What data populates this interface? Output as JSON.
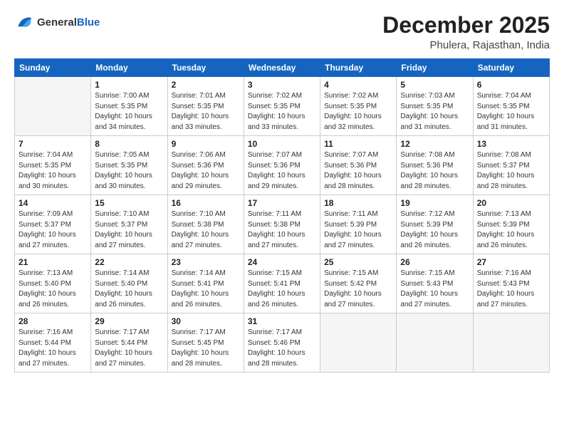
{
  "logo": {
    "general": "General",
    "blue": "Blue"
  },
  "header": {
    "month": "December 2025",
    "location": "Phulera, Rajasthan, India"
  },
  "weekdays": [
    "Sunday",
    "Monday",
    "Tuesday",
    "Wednesday",
    "Thursday",
    "Friday",
    "Saturday"
  ],
  "weeks": [
    [
      {
        "day": "",
        "info": ""
      },
      {
        "day": "1",
        "info": "Sunrise: 7:00 AM\nSunset: 5:35 PM\nDaylight: 10 hours\nand 34 minutes."
      },
      {
        "day": "2",
        "info": "Sunrise: 7:01 AM\nSunset: 5:35 PM\nDaylight: 10 hours\nand 33 minutes."
      },
      {
        "day": "3",
        "info": "Sunrise: 7:02 AM\nSunset: 5:35 PM\nDaylight: 10 hours\nand 33 minutes."
      },
      {
        "day": "4",
        "info": "Sunrise: 7:02 AM\nSunset: 5:35 PM\nDaylight: 10 hours\nand 32 minutes."
      },
      {
        "day": "5",
        "info": "Sunrise: 7:03 AM\nSunset: 5:35 PM\nDaylight: 10 hours\nand 31 minutes."
      },
      {
        "day": "6",
        "info": "Sunrise: 7:04 AM\nSunset: 5:35 PM\nDaylight: 10 hours\nand 31 minutes."
      }
    ],
    [
      {
        "day": "7",
        "info": "Sunrise: 7:04 AM\nSunset: 5:35 PM\nDaylight: 10 hours\nand 30 minutes."
      },
      {
        "day": "8",
        "info": "Sunrise: 7:05 AM\nSunset: 5:35 PM\nDaylight: 10 hours\nand 30 minutes."
      },
      {
        "day": "9",
        "info": "Sunrise: 7:06 AM\nSunset: 5:36 PM\nDaylight: 10 hours\nand 29 minutes."
      },
      {
        "day": "10",
        "info": "Sunrise: 7:07 AM\nSunset: 5:36 PM\nDaylight: 10 hours\nand 29 minutes."
      },
      {
        "day": "11",
        "info": "Sunrise: 7:07 AM\nSunset: 5:36 PM\nDaylight: 10 hours\nand 28 minutes."
      },
      {
        "day": "12",
        "info": "Sunrise: 7:08 AM\nSunset: 5:36 PM\nDaylight: 10 hours\nand 28 minutes."
      },
      {
        "day": "13",
        "info": "Sunrise: 7:08 AM\nSunset: 5:37 PM\nDaylight: 10 hours\nand 28 minutes."
      }
    ],
    [
      {
        "day": "14",
        "info": "Sunrise: 7:09 AM\nSunset: 5:37 PM\nDaylight: 10 hours\nand 27 minutes."
      },
      {
        "day": "15",
        "info": "Sunrise: 7:10 AM\nSunset: 5:37 PM\nDaylight: 10 hours\nand 27 minutes."
      },
      {
        "day": "16",
        "info": "Sunrise: 7:10 AM\nSunset: 5:38 PM\nDaylight: 10 hours\nand 27 minutes."
      },
      {
        "day": "17",
        "info": "Sunrise: 7:11 AM\nSunset: 5:38 PM\nDaylight: 10 hours\nand 27 minutes."
      },
      {
        "day": "18",
        "info": "Sunrise: 7:11 AM\nSunset: 5:39 PM\nDaylight: 10 hours\nand 27 minutes."
      },
      {
        "day": "19",
        "info": "Sunrise: 7:12 AM\nSunset: 5:39 PM\nDaylight: 10 hours\nand 26 minutes."
      },
      {
        "day": "20",
        "info": "Sunrise: 7:13 AM\nSunset: 5:39 PM\nDaylight: 10 hours\nand 26 minutes."
      }
    ],
    [
      {
        "day": "21",
        "info": "Sunrise: 7:13 AM\nSunset: 5:40 PM\nDaylight: 10 hours\nand 26 minutes."
      },
      {
        "day": "22",
        "info": "Sunrise: 7:14 AM\nSunset: 5:40 PM\nDaylight: 10 hours\nand 26 minutes."
      },
      {
        "day": "23",
        "info": "Sunrise: 7:14 AM\nSunset: 5:41 PM\nDaylight: 10 hours\nand 26 minutes."
      },
      {
        "day": "24",
        "info": "Sunrise: 7:15 AM\nSunset: 5:41 PM\nDaylight: 10 hours\nand 26 minutes."
      },
      {
        "day": "25",
        "info": "Sunrise: 7:15 AM\nSunset: 5:42 PM\nDaylight: 10 hours\nand 27 minutes."
      },
      {
        "day": "26",
        "info": "Sunrise: 7:15 AM\nSunset: 5:43 PM\nDaylight: 10 hours\nand 27 minutes."
      },
      {
        "day": "27",
        "info": "Sunrise: 7:16 AM\nSunset: 5:43 PM\nDaylight: 10 hours\nand 27 minutes."
      }
    ],
    [
      {
        "day": "28",
        "info": "Sunrise: 7:16 AM\nSunset: 5:44 PM\nDaylight: 10 hours\nand 27 minutes."
      },
      {
        "day": "29",
        "info": "Sunrise: 7:17 AM\nSunset: 5:44 PM\nDaylight: 10 hours\nand 27 minutes."
      },
      {
        "day": "30",
        "info": "Sunrise: 7:17 AM\nSunset: 5:45 PM\nDaylight: 10 hours\nand 28 minutes."
      },
      {
        "day": "31",
        "info": "Sunrise: 7:17 AM\nSunset: 5:46 PM\nDaylight: 10 hours\nand 28 minutes."
      },
      {
        "day": "",
        "info": ""
      },
      {
        "day": "",
        "info": ""
      },
      {
        "day": "",
        "info": ""
      }
    ]
  ]
}
